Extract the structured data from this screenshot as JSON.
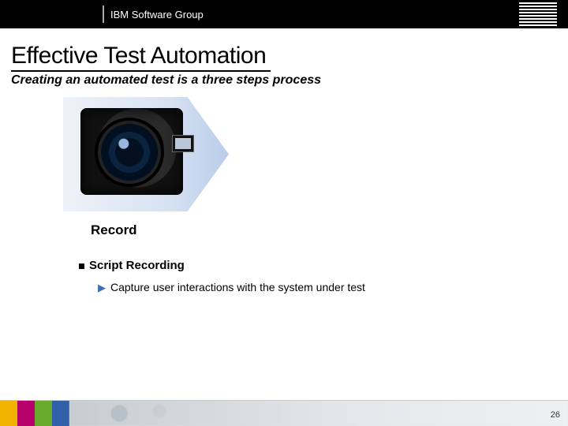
{
  "header": {
    "group": "IBM Software Group"
  },
  "title": "Effective Test Automation",
  "subtitle": "Creating an automated test is a three steps process",
  "step": {
    "label": "Record"
  },
  "bullets": {
    "l1": "Script Recording",
    "l2": "Capture user interactions with the system under test"
  },
  "page_number": "26"
}
